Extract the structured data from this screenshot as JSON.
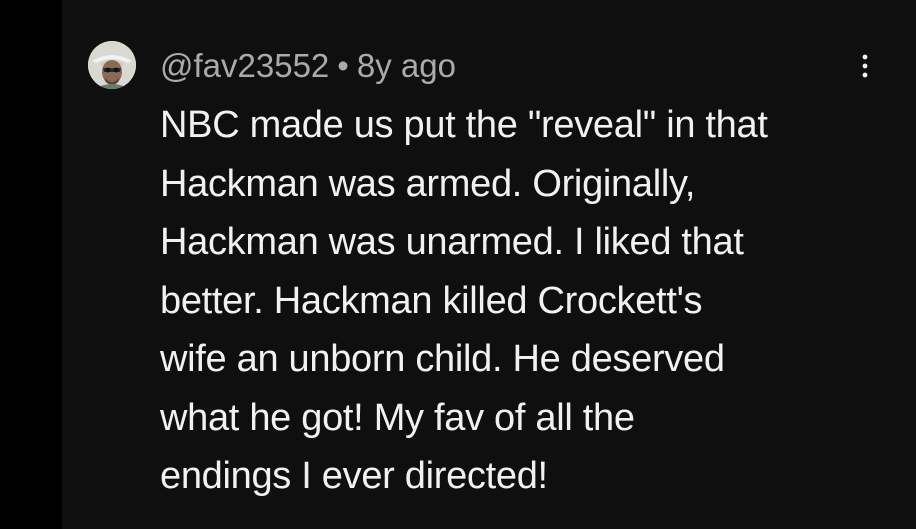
{
  "comment": {
    "author": "@fav23552",
    "separator": "•",
    "age": "8y ago",
    "lines": [
      "NBC made us put the \"reveal\" in that",
      "Hackman was armed. Originally,",
      "Hackman was unarmed. I liked that",
      "better. Hackman killed Crockett's",
      "wife an unborn child. He deserved",
      "what he got! My fav of all the",
      "endings I ever directed!"
    ]
  },
  "icons": {
    "avatar": "user-avatar-icon",
    "menu": "more-vertical-icon"
  },
  "colors": {
    "background": "#0f0f0f",
    "page_edge": "#000000",
    "author_text": "#aaaaaa",
    "comment_text": "#f1f1f1"
  }
}
